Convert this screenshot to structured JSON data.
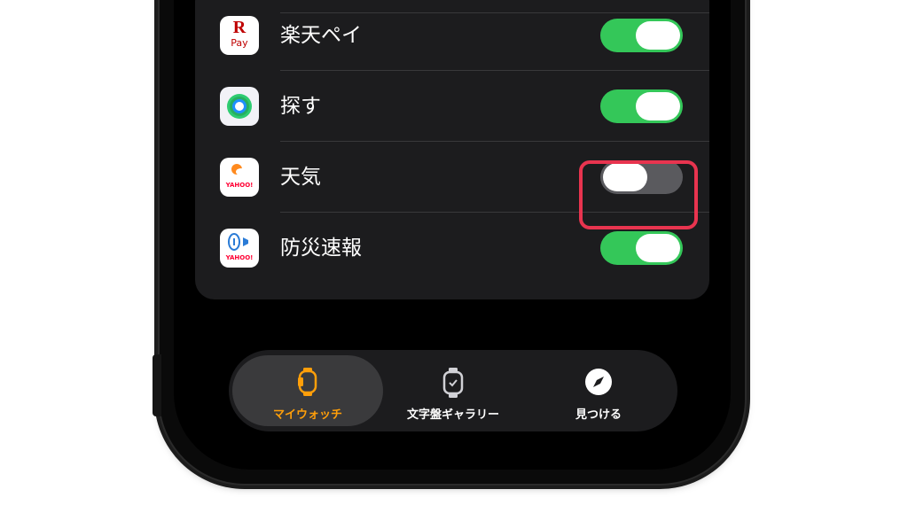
{
  "settings": {
    "rows": [
      {
        "label": "",
        "toggle_on": true,
        "icon": "app-icon"
      },
      {
        "label": "楽天ペイ",
        "toggle_on": true,
        "icon": "rakuten-pay-icon",
        "icon_text_top": "R",
        "icon_text_bottom": "Pay"
      },
      {
        "label": "探す",
        "toggle_on": true,
        "icon": "find-my-icon"
      },
      {
        "label": "天気",
        "toggle_on": false,
        "icon": "yahoo-weather-icon",
        "icon_text": "YAHOO!"
      },
      {
        "label": "防災速報",
        "toggle_on": true,
        "icon": "yahoo-disaster-alert-icon",
        "icon_text": "YAHOO!"
      }
    ]
  },
  "tabbar": {
    "tabs": [
      {
        "label": "マイウォッチ",
        "icon": "watch-icon",
        "active": true
      },
      {
        "label": "文字盤ギャラリー",
        "icon": "watch-face-icon",
        "active": false
      },
      {
        "label": "見つける",
        "icon": "compass-icon",
        "active": false
      }
    ]
  },
  "colors": {
    "toggle_on": "#34c759",
    "toggle_off": "#5a5a5e",
    "highlight": "#e8344f",
    "active_tab": "#ff9f0a",
    "card_bg": "#1c1c1e"
  }
}
